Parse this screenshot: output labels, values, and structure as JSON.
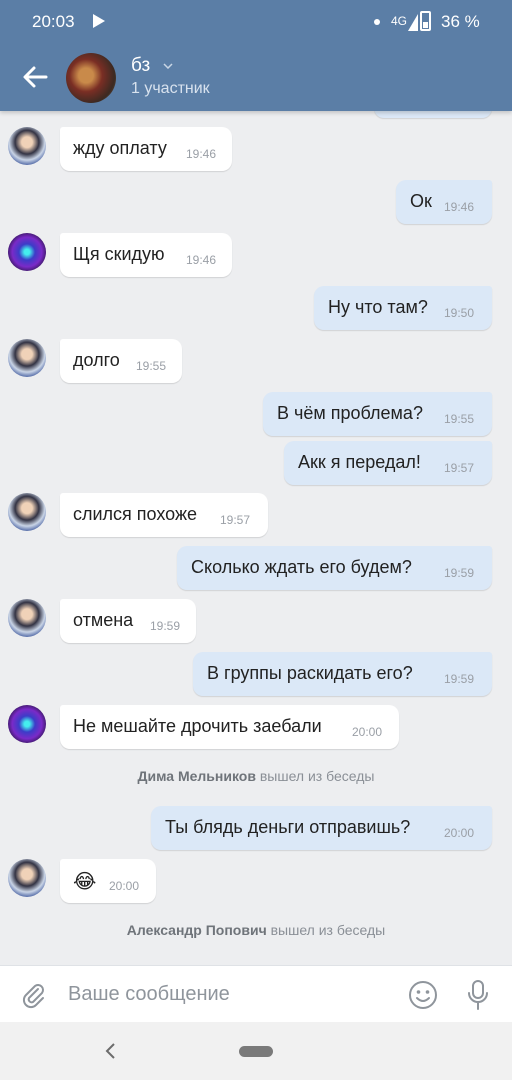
{
  "status_bar": {
    "time": "20:03",
    "network": "4G",
    "battery": "36 %"
  },
  "header": {
    "title": "бз",
    "subtitle": "1 участник"
  },
  "messages": [
    {
      "dir": "in",
      "text": "жду оплату",
      "time": "19:46"
    },
    {
      "dir": "out",
      "text": "Ок",
      "time": "19:46"
    },
    {
      "dir": "in",
      "text": "Щя скидую",
      "time": "19:46"
    },
    {
      "dir": "out",
      "text": "Ну что там?",
      "time": "19:50"
    },
    {
      "dir": "in",
      "text": "долго",
      "time": "19:55"
    },
    {
      "dir": "out",
      "text": "В чём проблема?",
      "time": "19:55"
    },
    {
      "dir": "out",
      "text": "Акк я передал!",
      "time": "19:57"
    },
    {
      "dir": "in",
      "text": "слился похоже",
      "time": "19:57"
    },
    {
      "dir": "out",
      "text": "Сколько ждать его будем?",
      "time": "19:59"
    },
    {
      "dir": "in",
      "text": "отмена",
      "time": "19:59"
    },
    {
      "dir": "out",
      "text": "В группы раскидать его?",
      "time": "19:59"
    },
    {
      "dir": "in",
      "text": "Не мешайте дрочить заебали",
      "time": "20:00"
    },
    {
      "dir": "out",
      "text": "Ты блядь деньги отправишь?",
      "time": "20:00"
    },
    {
      "dir": "in",
      "text": "😂",
      "time": "20:00"
    }
  ],
  "system_events": [
    {
      "name": "Дима Мельников",
      "action": "вышел из беседы"
    },
    {
      "name": "Александр Попович",
      "action": "вышел из беседы"
    }
  ],
  "composer": {
    "placeholder": "Ваше сообщение"
  },
  "colors": {
    "header": "#5b7ea6",
    "background": "#edeef0",
    "outgoing": "#dbe8f7",
    "incoming": "#ffffff"
  }
}
